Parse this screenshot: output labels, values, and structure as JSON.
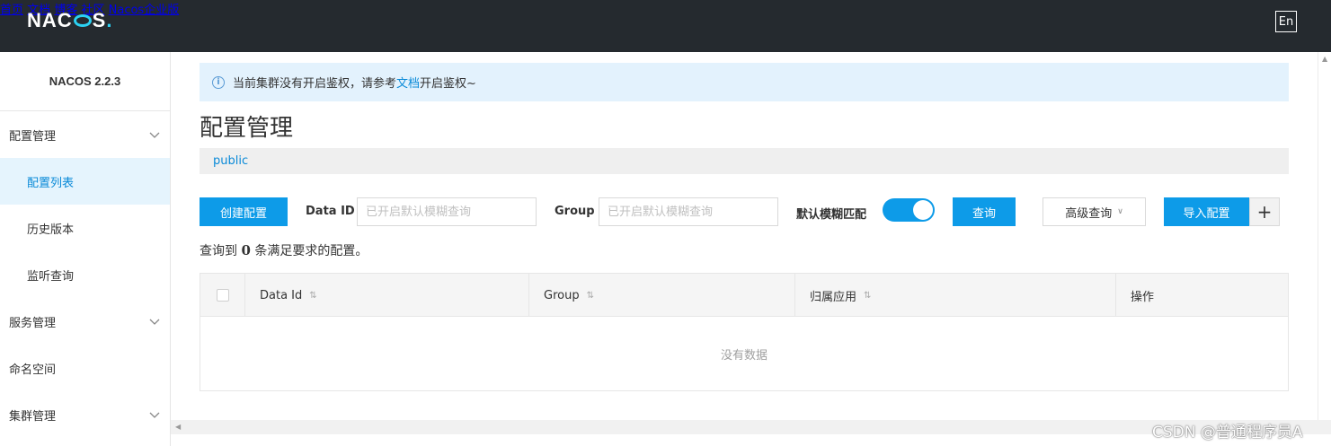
{
  "header": {
    "logo_text": "NACOS.",
    "nav": [
      "首页",
      "文档",
      "博客",
      "社区",
      "Nacos企业版"
    ],
    "lang_button": "En"
  },
  "sidebar": {
    "version": "NACOS 2.2.3",
    "items": [
      {
        "label": "配置管理",
        "expandable": true
      },
      {
        "label": "配置列表",
        "active": true
      },
      {
        "label": "历史版本"
      },
      {
        "label": "监听查询"
      },
      {
        "label": "服务管理",
        "expandable": true
      },
      {
        "label": "命名空间"
      },
      {
        "label": "集群管理",
        "expandable": true
      }
    ]
  },
  "notice": {
    "before": "当前集群没有开启鉴权，请参考",
    "link": "文档",
    "after": "开启鉴权~"
  },
  "page_title": "配置管理",
  "namespace": "public",
  "toolbar": {
    "create_label": "创建配置",
    "data_id_label": "Data ID",
    "data_id_placeholder": "已开启默认模糊查询",
    "group_label": "Group",
    "group_placeholder": "已开启默认模糊查询",
    "fuzzy_label": "默认模糊匹配",
    "fuzzy_on": true,
    "search_label": "查询",
    "advanced_label": "高级查询",
    "import_label": "导入配置",
    "plus_label": "+"
  },
  "result": {
    "before": "查询到 ",
    "count": "0",
    "after": " 条满足要求的配置。"
  },
  "table": {
    "columns": [
      "Data Id",
      "Group",
      "归属应用",
      "操作"
    ],
    "empty_text": "没有数据"
  },
  "watermark": "CSDN @普通程序员A",
  "colors": {
    "header_bg": "#252a2f",
    "primary": "#0d9be8",
    "link": "#0a8ad8",
    "notice_bg": "#e3f2fd",
    "active_bg": "#e5f4fd"
  }
}
